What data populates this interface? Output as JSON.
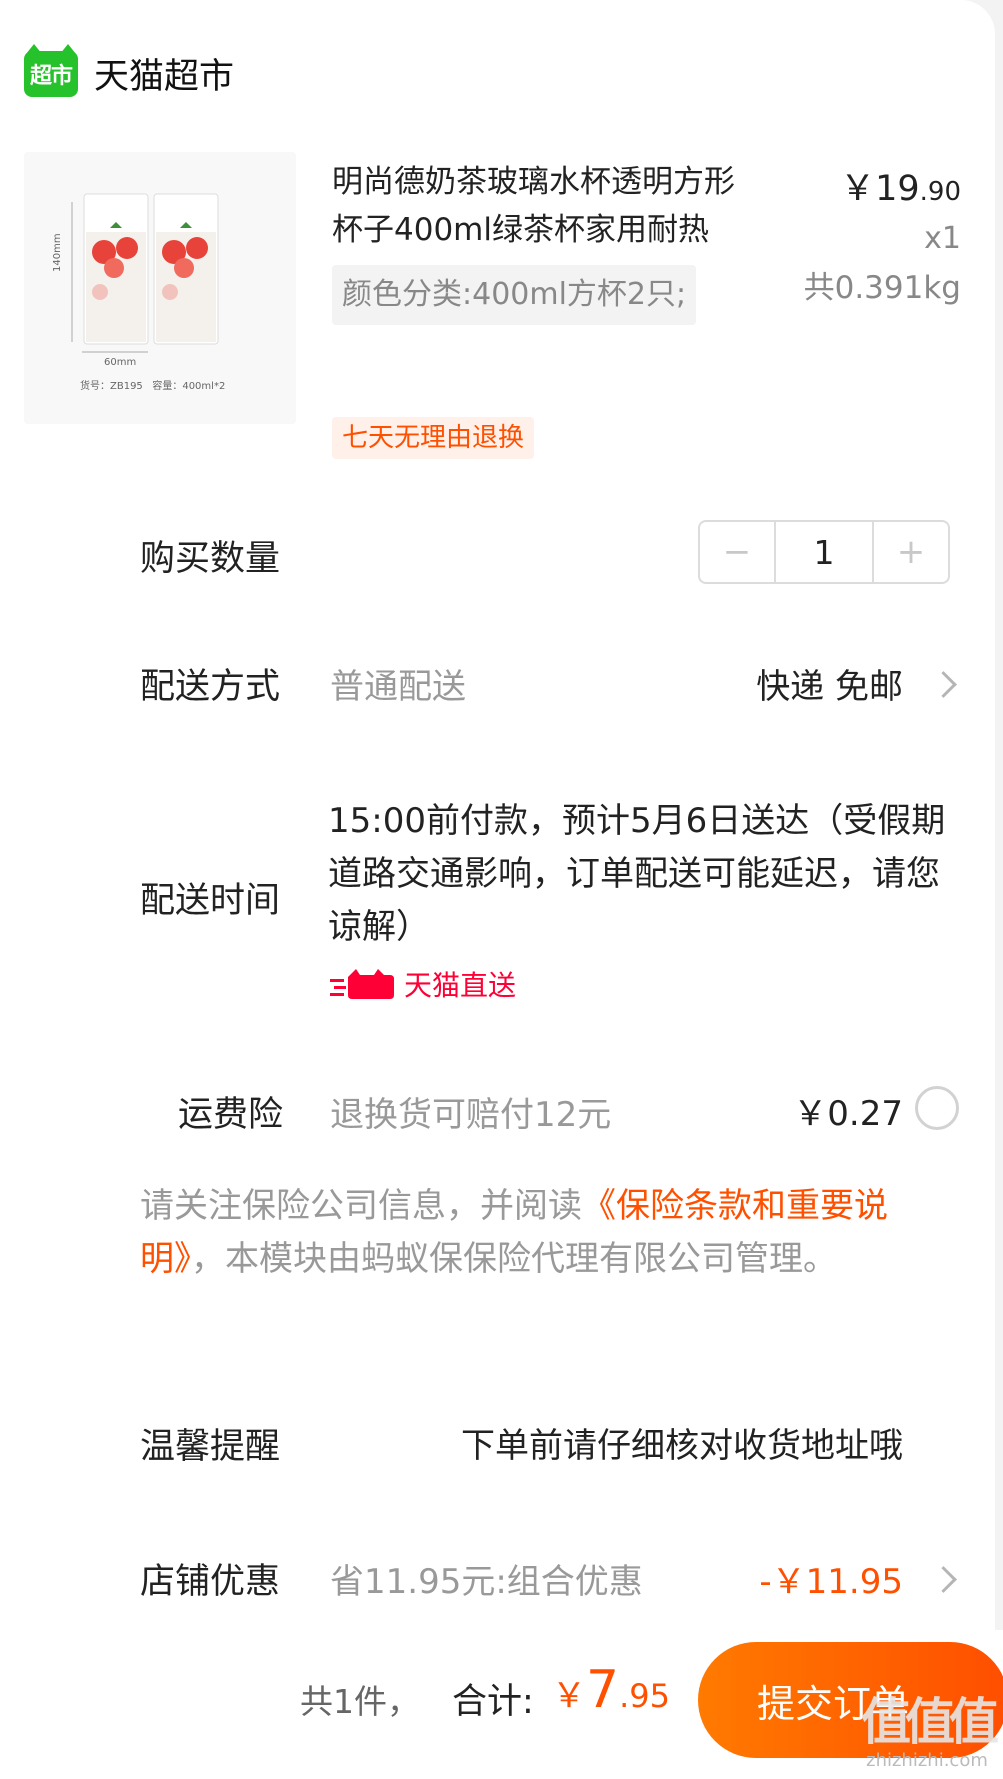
{
  "store": {
    "logo_text": "超市",
    "name": "天猫超市"
  },
  "product": {
    "image_labels": {
      "height": "140mm",
      "width": "60mm",
      "spec": "货号：ZB195   容量：400ml*2"
    },
    "title": "明尚德奶茶玻璃水杯透明方形杯子400ml绿茶杯家用耐热",
    "sku": "颜色分类:400ml方杯2只;",
    "price_int": "￥19",
    "price_dec": ".90",
    "quantity": "x1",
    "weight": "共0.391kg",
    "return_tag": "七天无理由退换"
  },
  "purchase_qty": {
    "label": "购买数量",
    "minus": "−",
    "value": "1",
    "plus": "+"
  },
  "shipping": {
    "label": "配送方式",
    "sub": "普通配送",
    "value": "快递 免邮"
  },
  "delivery_time": {
    "label": "配送时间",
    "text": "15:00前付款，预计5月6日送达（受假期道路交通影响，订单配送可能延迟，请您谅解）",
    "badge": "天猫直送",
    "badge_color": "#ff0036"
  },
  "insurance": {
    "label": "运费险",
    "sub": "退换货可赔付12元",
    "price": "￥0.27",
    "note_prefix": "请关注保险公司信息，并阅读",
    "note_link": "《保险条款和重要说明》",
    "note_suffix": "，本模块由蚂蚁保保险代理有限公司管理。"
  },
  "reminder": {
    "label": "温馨提醒",
    "text": "下单前请仔细核对收货地址哦"
  },
  "store_discount": {
    "label": "店铺优惠",
    "sub": "省11.95元:组合优惠",
    "value": "-￥11.95"
  },
  "bottom": {
    "count": "共1件，",
    "total_label": "合计:",
    "cur": "￥",
    "amount_int": "7",
    "amount_dec": ".95",
    "submit": "提交订单",
    "accent": "#ff5000"
  },
  "watermark": {
    "logo": "值值值",
    "text": "zhizhizhi.com"
  }
}
